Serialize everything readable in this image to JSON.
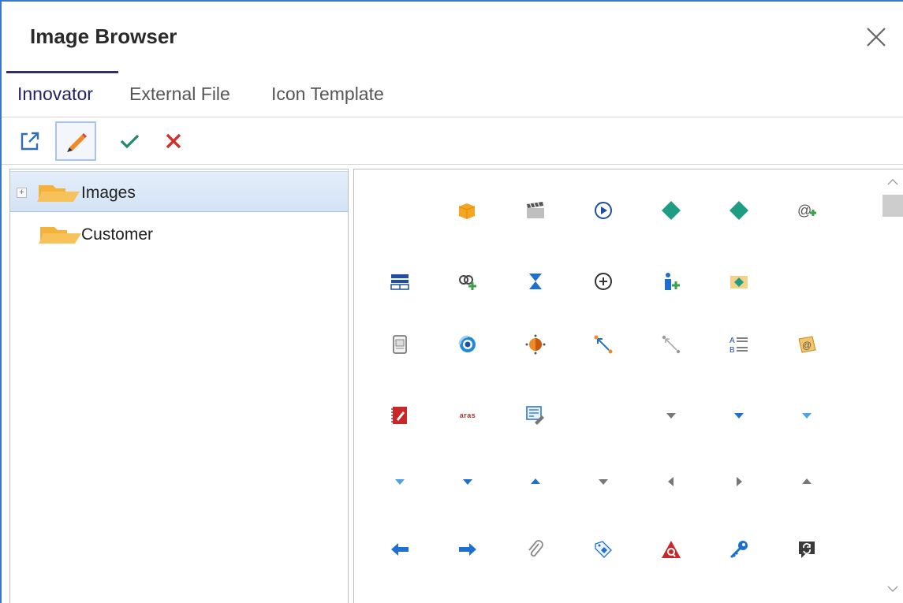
{
  "dialog": {
    "title": "Image Browser",
    "close_glyph": "✕"
  },
  "tabs": [
    {
      "label": "Innovator",
      "active": true
    },
    {
      "label": "External File",
      "active": false
    },
    {
      "label": "Icon Template",
      "active": false
    }
  ],
  "toolbar": {
    "buttons": [
      {
        "name": "open-external-icon"
      },
      {
        "name": "edit-pencil-icon",
        "active": true
      },
      {
        "name": "check-icon"
      },
      {
        "name": "delete-x-icon"
      }
    ]
  },
  "tree": {
    "items": [
      {
        "label": "Images",
        "expander": "+",
        "selected": true
      },
      {
        "label": "Customer",
        "selected": false
      }
    ]
  },
  "icons": [
    [
      "blank",
      "orange-cube-icon",
      "clapperboard-icon",
      "play-circle-icon",
      "teal-diamond-icon",
      "teal-diamond-icon",
      "at-plus-icon"
    ],
    [
      "table-icon",
      "link-plus-icon",
      "hourglass-icon",
      "plus-circle-icon",
      "user-plus-icon",
      "folder-diamond-icon",
      "blank"
    ],
    [
      "document-icon",
      "swirl-icon",
      "orange-node-icon",
      "diagonal-arrows-icon",
      "diagonal-arrows-gray-icon",
      "text-list-icon",
      "email-ticket-icon"
    ],
    [
      "red-notebook-icon",
      "aras-logo-icon",
      "form-edit-icon",
      "blank",
      "gray-down-triangle-icon",
      "blue-down-triangle-icon",
      "light-blue-down-triangle-icon"
    ],
    [
      "light-blue-down-triangle-icon",
      "blue-down-triangle-icon",
      "blue-up-triangle-icon",
      "gray-down-triangle-icon",
      "gray-left-triangle-icon",
      "gray-right-triangle-icon",
      "gray-up-triangle-icon"
    ],
    [
      "blue-left-arrow-icon",
      "blue-right-arrow-icon",
      "paperclip-icon",
      "tag-diamond-icon",
      "red-warning-search-icon",
      "blue-key-icon",
      "refresh-comment-icon"
    ]
  ],
  "aras_logo_text": "aras"
}
